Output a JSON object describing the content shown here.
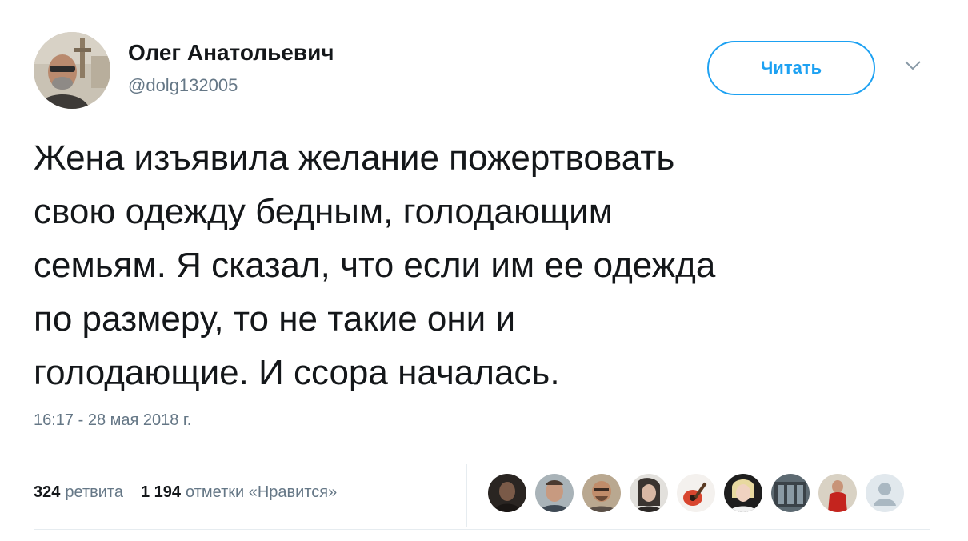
{
  "author": {
    "display_name": "Олег Анатольевич",
    "handle": "@dolg132005"
  },
  "follow_button": {
    "label": "Читать"
  },
  "tweet": {
    "text_lines": [
      "Жена изъявила желание пожертвовать",
      "свою одежду бедным, голодающим",
      "семьям. Я сказал, что если им ее одежда",
      "по размеру, то не такие они и",
      "голодающие. И ссора началась."
    ],
    "timestamp": "16:17 - 28 мая 2018 г."
  },
  "stats": {
    "retweets_count": "324",
    "retweets_label": "ретвита",
    "likes_count": "1 194",
    "likes_label": "отметки «Нравится»"
  },
  "likers": [
    {
      "icon": "user-avatar-1"
    },
    {
      "icon": "user-avatar-2"
    },
    {
      "icon": "user-avatar-3"
    },
    {
      "icon": "user-avatar-4"
    },
    {
      "icon": "user-avatar-5"
    },
    {
      "icon": "user-avatar-6"
    },
    {
      "icon": "user-avatar-7"
    },
    {
      "icon": "user-avatar-8"
    },
    {
      "icon": "default-avatar"
    }
  ],
  "colors": {
    "accent": "#1da1f2",
    "text": "#14171a",
    "secondary": "#657786",
    "divider": "#e6ecf0"
  }
}
